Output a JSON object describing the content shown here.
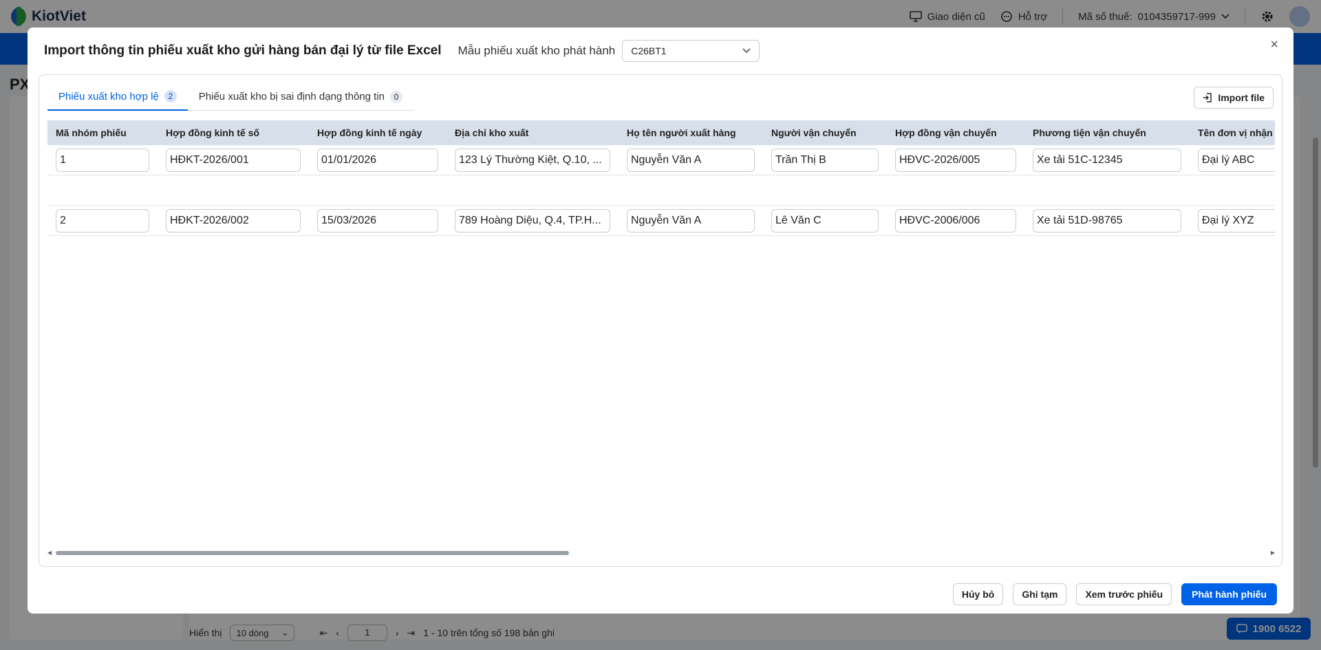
{
  "app": {
    "logo_text": "KiotViet",
    "header": {
      "old_ui": "Giao diện cũ",
      "support": "Hỗ trợ",
      "tax_label": "Mã số thuế:",
      "tax_value": "0104359717-999"
    },
    "page_title": "PX",
    "footer": {
      "show_label": "Hiển thị",
      "page_size": "10 dòng",
      "page_number": "1",
      "range_text": "1 - 10 trên tổng số 198 bản ghi"
    },
    "hotline": "1900 6522"
  },
  "modal": {
    "title": "Import thông tin phiếu xuất kho gửi hàng bán đại lý từ file Excel",
    "template_label": "Mẫu phiếu xuất kho phát hành",
    "template_value": "C26BT1",
    "close_icon": "×",
    "tabs": [
      {
        "label": "Phiếu xuất kho hợp lệ",
        "count": "2"
      },
      {
        "label": "Phiếu xuất kho bị sai định dạng thông tin",
        "count": "0"
      }
    ],
    "import_button": "Import file",
    "columns": [
      "Mã nhóm phiếu",
      "Hợp đồng kinh tế số",
      "Hợp đồng kinh tế ngày",
      "Địa chỉ kho xuất",
      "Họ tên người xuất hàng",
      "Người vận chuyển",
      "Hợp đồng vận chuyển",
      "Phương tiện vận chuyển",
      "Tên đơn vị nhận"
    ],
    "rows": [
      [
        "1",
        "HĐKT-2026/001",
        "01/01/2026",
        "123 Lý Thường Kiệt, Q.10, ...",
        "Nguyễn Văn A",
        "Trần Thị B",
        "HĐVC-2026/005",
        "Xe tải 51C-12345",
        "Đại lý ABC"
      ],
      [
        "2",
        "HĐKT-2026/002",
        "15/03/2026",
        "789 Hoàng Diệu, Q.4, TP.H...",
        "Nguyễn Văn A",
        "Lê Văn C",
        "HĐVC-2006/006",
        "Xe tải 51D-98765",
        "Đại lý XYZ"
      ]
    ],
    "buttons": {
      "cancel": "Hủy bỏ",
      "save_draft": "Ghi tạm",
      "preview": "Xem trước phiếu",
      "issue": "Phát hành phiếu"
    }
  },
  "colors": {
    "primary": "#0062e6",
    "header_row": "#d7dfea"
  }
}
